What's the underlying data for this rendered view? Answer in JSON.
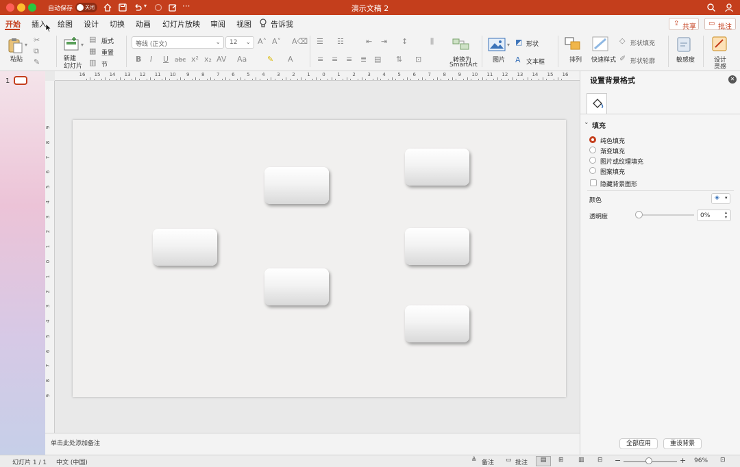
{
  "window": {
    "title": "演示文稿 2",
    "autosave_label": "自动保存",
    "autosave_state": "关闭"
  },
  "tabs": [
    "开始",
    "插入",
    "绘图",
    "设计",
    "切换",
    "动画",
    "幻灯片放映",
    "审阅",
    "视图"
  ],
  "tell_me": "告诉我",
  "share_label": "共享",
  "comments_label": "批注",
  "ribbon": {
    "paste": "粘贴",
    "new_slide": [
      "新建",
      "幻灯片"
    ],
    "layout": "版式",
    "reset": "重置",
    "section": "节",
    "font_name": "等线 (正文)",
    "font_size": "12",
    "smartart": [
      "转换为",
      "SmartArt"
    ],
    "picture": "图片",
    "shapes": "形状",
    "textbox": "文本框",
    "arrange": "排列",
    "quick_styles": "快速样式",
    "shape_fill": "形状填充",
    "shape_outline": "形状轮廓",
    "sensitivity": "敏感度",
    "designer": [
      "设计",
      "灵感"
    ],
    "format_row": [
      "B",
      "I",
      "U",
      "abc",
      "x²",
      "x₂",
      "AV",
      "Aa"
    ]
  },
  "thumbnail_number": "1",
  "ruler_h": [
    "16",
    "15",
    "14",
    "13",
    "12",
    "11",
    "10",
    "9",
    "8",
    "7",
    "6",
    "5",
    "4",
    "3",
    "2",
    "1",
    "0",
    "1",
    "2",
    "3",
    "4",
    "5",
    "6",
    "7",
    "8",
    "9",
    "10",
    "11",
    "12",
    "13",
    "14",
    "15",
    "16"
  ],
  "ruler_v": [
    "9",
    "8",
    "7",
    "6",
    "5",
    "4",
    "3",
    "2",
    "1",
    "0",
    "1",
    "2",
    "3",
    "4",
    "5",
    "6",
    "7",
    "8",
    "9"
  ],
  "notes_placeholder": "单击此处添加备注",
  "slide": {
    "shapes_count_visible": 6
  },
  "panel": {
    "title": "设置背景格式",
    "section": "填充",
    "options": [
      {
        "label": "纯色填充",
        "selected": true
      },
      {
        "label": "渐变填充",
        "selected": false
      },
      {
        "label": "图片或纹理填充",
        "selected": false
      },
      {
        "label": "图案填充",
        "selected": false
      }
    ],
    "hide_bg_graphics": "隐藏背景图形",
    "color_label": "颜色",
    "transparency_label": "透明度",
    "transparency_value": "0%",
    "transparency_level": 0,
    "apply_all": "全部应用",
    "reset_bg": "重设背景"
  },
  "status": {
    "slide_info": "幻灯片 1 / 1",
    "language": "中文 (中国)",
    "notes": "备注",
    "comments": "批注",
    "zoom": "96%",
    "zoom_level": 0.96
  },
  "colors": {
    "accent": "#c43e1c",
    "canvas": "#f1f0ef"
  }
}
